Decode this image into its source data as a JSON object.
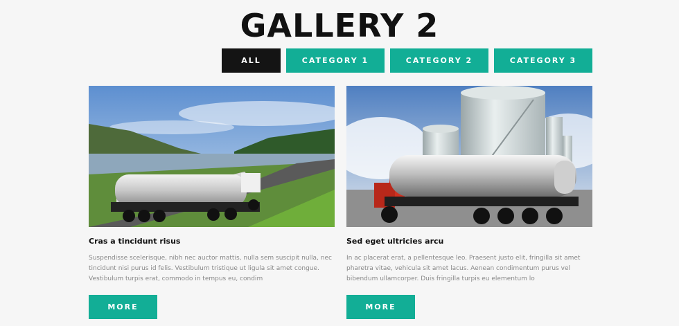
{
  "page": {
    "title": "GALLERY 2"
  },
  "filters": [
    {
      "label": "ALL"
    },
    {
      "label": "CATEGORY 1"
    },
    {
      "label": "CATEGORY 2"
    },
    {
      "label": "CATEGORY 3"
    }
  ],
  "items": [
    {
      "image": "tanker-truck-road-lake",
      "title": "Cras a tincidunt risus",
      "text": "Suspendisse scelerisque, nibh nec auctor mattis, nulla sem suscipit nulla, nec tincidunt nisi purus id felis. Vestibulum tristique ut ligula sit amet congue. Vestibulum turpis erat, commodo in tempus eu, condim",
      "button": "MORE"
    },
    {
      "image": "tanker-truck-storage-tanks",
      "title": "Sed eget ultricies arcu",
      "text": "In ac placerat erat, a pellentesque leo. Praesent justo elit, fringilla sit amet pharetra vitae, vehicula sit amet lacus. Aenean condimentum purus vel bibendum ullamcorper. Duis fringilla turpis eu elementum lo",
      "button": "MORE"
    }
  ],
  "colors": {
    "accent": "#12ae96",
    "active": "#141414",
    "background": "#f6f6f6"
  }
}
